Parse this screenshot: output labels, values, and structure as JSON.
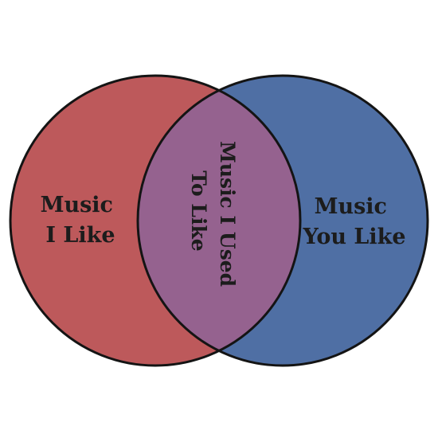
{
  "diagram": {
    "type": "venn",
    "sets": [
      {
        "id": "left",
        "label_lines": [
          "Music",
          "I Like"
        ],
        "color": "#bd595b"
      },
      {
        "id": "right",
        "label_lines": [
          "Music",
          "You Like"
        ],
        "color": "#4f6fa4"
      }
    ],
    "intersection": {
      "label_lines": [
        "Music I Used",
        "To Like"
      ],
      "color": "#95628f"
    },
    "outline_color": "#141414"
  }
}
